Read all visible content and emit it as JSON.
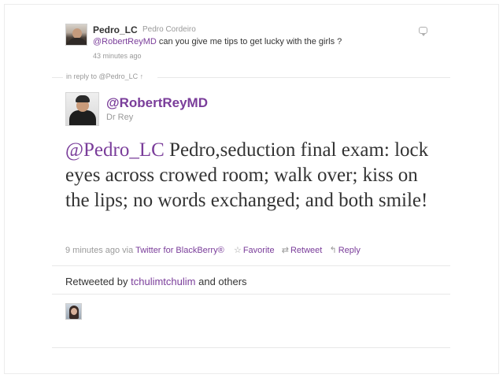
{
  "parent_tweet": {
    "screen_name": "Pedro_LC",
    "full_name": "Pedro Cordeiro",
    "mention": "@RobertReyMD",
    "text": " can you give me tips to get lucky with the girls ?",
    "timestamp": "43 minutes ago",
    "avatar_icon": "user-photo-icon",
    "reply_icon": "reply-bubble-icon"
  },
  "in_reply_to": "in reply to @Pedro_LC ↑",
  "main_tweet": {
    "screen_name": "@RobertReyMD",
    "full_name": "Dr Rey",
    "mention": "@Pedro_LC",
    "text": " Pedro,seduction final exam: lock eyes across crowed room; walk over; kiss on the lips; no words exchanged; and both smile!",
    "timestamp": "9 minutes ago via",
    "source": "Twitter for BlackBerry®",
    "actions": {
      "favorite": "Favorite",
      "retweet": "Retweet",
      "reply": "Reply"
    }
  },
  "retweeted": {
    "prefix": "Retweeted by",
    "user": "tchulimtchulim",
    "suffix": "and others"
  },
  "colors": {
    "link": "#7a3d9a",
    "meta": "#999999",
    "text": "#333333"
  }
}
